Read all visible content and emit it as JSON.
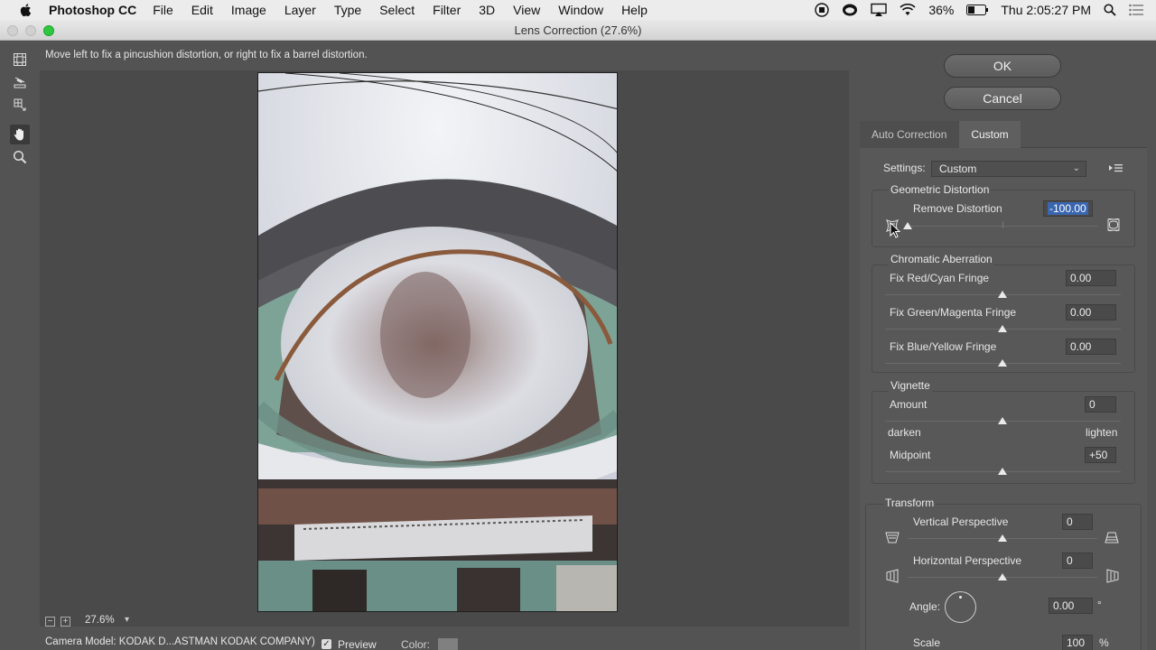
{
  "menubar": {
    "app_name": "Photoshop CC",
    "items": [
      "File",
      "Edit",
      "Image",
      "Layer",
      "Type",
      "Select",
      "Filter",
      "3D",
      "View",
      "Window",
      "Help"
    ],
    "battery": "36%",
    "clock": "Thu 2:05:27 PM"
  },
  "dialog": {
    "title": "Lens Correction (27.6%)",
    "hint": "Move left to fix a pincushion distortion, or right to fix a barrel distortion.",
    "ok_label": "OK",
    "cancel_label": "Cancel"
  },
  "tabs": {
    "auto": "Auto Correction",
    "custom": "Custom"
  },
  "settings": {
    "label": "Settings:",
    "value": "Custom"
  },
  "geometric": {
    "title": "Geometric Distortion",
    "remove_label": "Remove Distortion",
    "remove_value": "-100.00",
    "remove_level": -100
  },
  "chromatic": {
    "title": "Chromatic Aberration",
    "red_label": "Fix Red/Cyan Fringe",
    "red_value": "0.00",
    "green_label": "Fix Green/Magenta Fringe",
    "green_value": "0.00",
    "blue_label": "Fix Blue/Yellow Fringe",
    "blue_value": "0.00"
  },
  "vignette": {
    "title": "Vignette",
    "amount_label": "Amount",
    "amount_value": "0",
    "darken": "darken",
    "lighten": "lighten",
    "midpoint_label": "Midpoint",
    "midpoint_value": "+50"
  },
  "transform": {
    "title": "Transform",
    "vertical_label": "Vertical Perspective",
    "vertical_value": "0",
    "horizontal_label": "Horizontal Perspective",
    "horizontal_value": "0",
    "angle_label": "Angle:",
    "angle_value": "0.00",
    "angle_unit": "°",
    "scale_label": "Scale",
    "scale_value": "100",
    "scale_unit": "%"
  },
  "bottom": {
    "zoom": "27.6%",
    "camera_model": "Camera Model: KODAK D...ASTMAN KODAK COMPANY)",
    "preview_label": "Preview",
    "color_label": "Color:"
  },
  "colors": {
    "panel": "#585858",
    "selection": "#3a66b0",
    "max_button": "#2dc840"
  }
}
